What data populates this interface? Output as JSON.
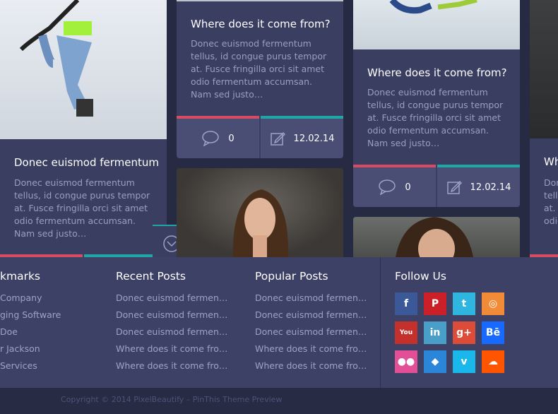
{
  "cards": [
    {
      "title": "Donec euismod fermentum",
      "excerpt": "Donec euismod fermentum tellus, id congue purus tempor at. Fusce fringilla orci sit amet odio fermentum accumsan. Nam sed justo…"
    },
    {
      "title": "Where does it come from?",
      "excerpt": "Donec euismod fermentum tellus, id congue purus tempor at. Fusce fringilla orci sit amet odio fermentum accumsan. Nam sed justo…",
      "comments": "0",
      "date": "12.02.14"
    },
    {
      "title": "Where does it come from?",
      "excerpt": "Donec euismod fermentum tellus, id congue purus tempor at. Fusce fringilla orci sit amet odio fermentum accumsan. Nam sed justo…",
      "comments": "0",
      "date": "12.02.14"
    },
    {
      "title": "Wh",
      "excerpt_lines": [
        "Dor",
        "tellu",
        "at. F",
        "odio"
      ]
    }
  ],
  "footer": {
    "bookmarks": {
      "heading": "kmarks",
      "items": [
        "Company",
        "ging Software",
        "Doe",
        "r Jackson",
        "Services"
      ]
    },
    "recent": {
      "heading": "Recent Posts",
      "items": [
        "Donec euismod fermen…",
        "Donec euismod fermen…",
        "Donec euismod fermen…",
        "Where does it come fro…",
        "Where does it come fro…"
      ]
    },
    "popular": {
      "heading": "Popular Posts",
      "items": [
        "Donec euismod fermen…",
        "Donec euismod fermen…",
        "Donec euismod fermen…",
        "Where does it come fro…",
        "Where does it come fro…"
      ]
    },
    "follow": {
      "heading": "Follow Us",
      "icons": [
        {
          "name": "facebook-icon",
          "glyph": "f",
          "color": "#3b5998"
        },
        {
          "name": "pinterest-icon",
          "glyph": "P",
          "color": "#cb2027"
        },
        {
          "name": "twitter-icon",
          "glyph": "t",
          "color": "#2fb6e0"
        },
        {
          "name": "instagram-icon",
          "glyph": "◎",
          "color": "#f28b38"
        },
        {
          "name": "youtube-icon",
          "glyph": "You",
          "color": "#c4302b"
        },
        {
          "name": "linkedin-icon",
          "glyph": "in",
          "color": "#4a9fc9"
        },
        {
          "name": "googleplus-icon",
          "glyph": "g+",
          "color": "#dd4b39"
        },
        {
          "name": "behance-icon",
          "glyph": "Bē",
          "color": "#1769ff"
        },
        {
          "name": "flickr-icon",
          "glyph": "●●",
          "color": "#e24f96"
        },
        {
          "name": "feedly-icon",
          "glyph": "◆",
          "color": "#2b86d9"
        },
        {
          "name": "vimeo-icon",
          "glyph": "v",
          "color": "#1ab7ea"
        },
        {
          "name": "soundcloud-icon",
          "glyph": "☁",
          "color": "#ff5500"
        }
      ]
    }
  },
  "copyright": "Copyright © 2014 PixelBeautify – PinThis Theme Preview"
}
